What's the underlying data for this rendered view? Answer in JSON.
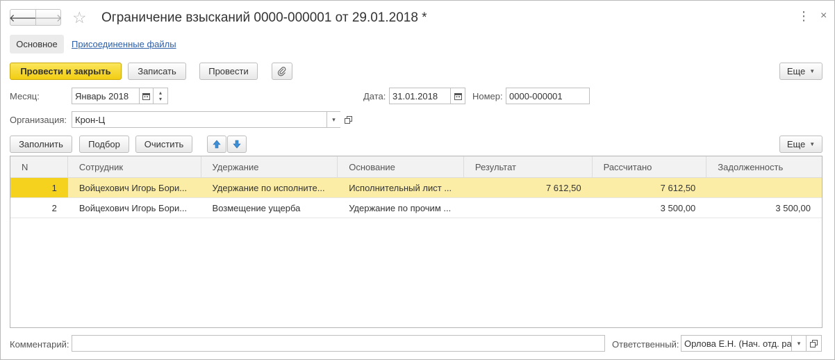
{
  "window": {
    "title": "Ограничение взысканий 0000-000001 от 29.01.2018 *",
    "back_glyph": "🡐",
    "forward_glyph": "🡒",
    "star_glyph": "☆",
    "more_glyph": "⋮",
    "close_glyph": "×"
  },
  "tabs": {
    "main": "Основное",
    "files": "Присоединенные файлы"
  },
  "toolbar": {
    "post_close": "Провести и закрыть",
    "save": "Записать",
    "post": "Провести",
    "attach_glyph": "📎",
    "more": "Еще"
  },
  "form": {
    "month_label": "Месяц:",
    "month_value": "Январь 2018",
    "date_label": "Дата:",
    "date_value": "31.01.2018",
    "number_label": "Номер:",
    "number_value": "0000-000001",
    "org_label": "Организация:",
    "org_value": "Крон-Ц",
    "comment_label": "Комментарий:",
    "comment_value": "",
    "responsible_label": "Ответственный:",
    "responsible_value": "Орлова Е.Н. (Нач. отд. ра"
  },
  "table_toolbar": {
    "fill": "Заполнить",
    "select": "Подбор",
    "clear": "Очистить",
    "more": "Еще"
  },
  "table": {
    "columns": [
      "N",
      "Сотрудник",
      "Удержание",
      "Основание",
      "Результат",
      "Рассчитано",
      "Задолженность"
    ],
    "rows": [
      {
        "n": "1",
        "employee": "Войцехович Игорь Бори...",
        "deduction": "Удержание по исполните...",
        "basis": "Исполнительный лист ...",
        "result": "7 612,50",
        "calculated": "7 612,50",
        "debt": ""
      },
      {
        "n": "2",
        "employee": "Войцехович Игорь Бори...",
        "deduction": "Возмещение ущерба",
        "basis": "Удержание по прочим ...",
        "result": "",
        "calculated": "3 500,00",
        "debt": "3 500,00"
      }
    ]
  },
  "colors": {
    "primary_button": "#f5d21e",
    "selected_row": "#fbeda5",
    "link": "#2c5fa8",
    "arrow_blue": "#3d8fd6"
  }
}
